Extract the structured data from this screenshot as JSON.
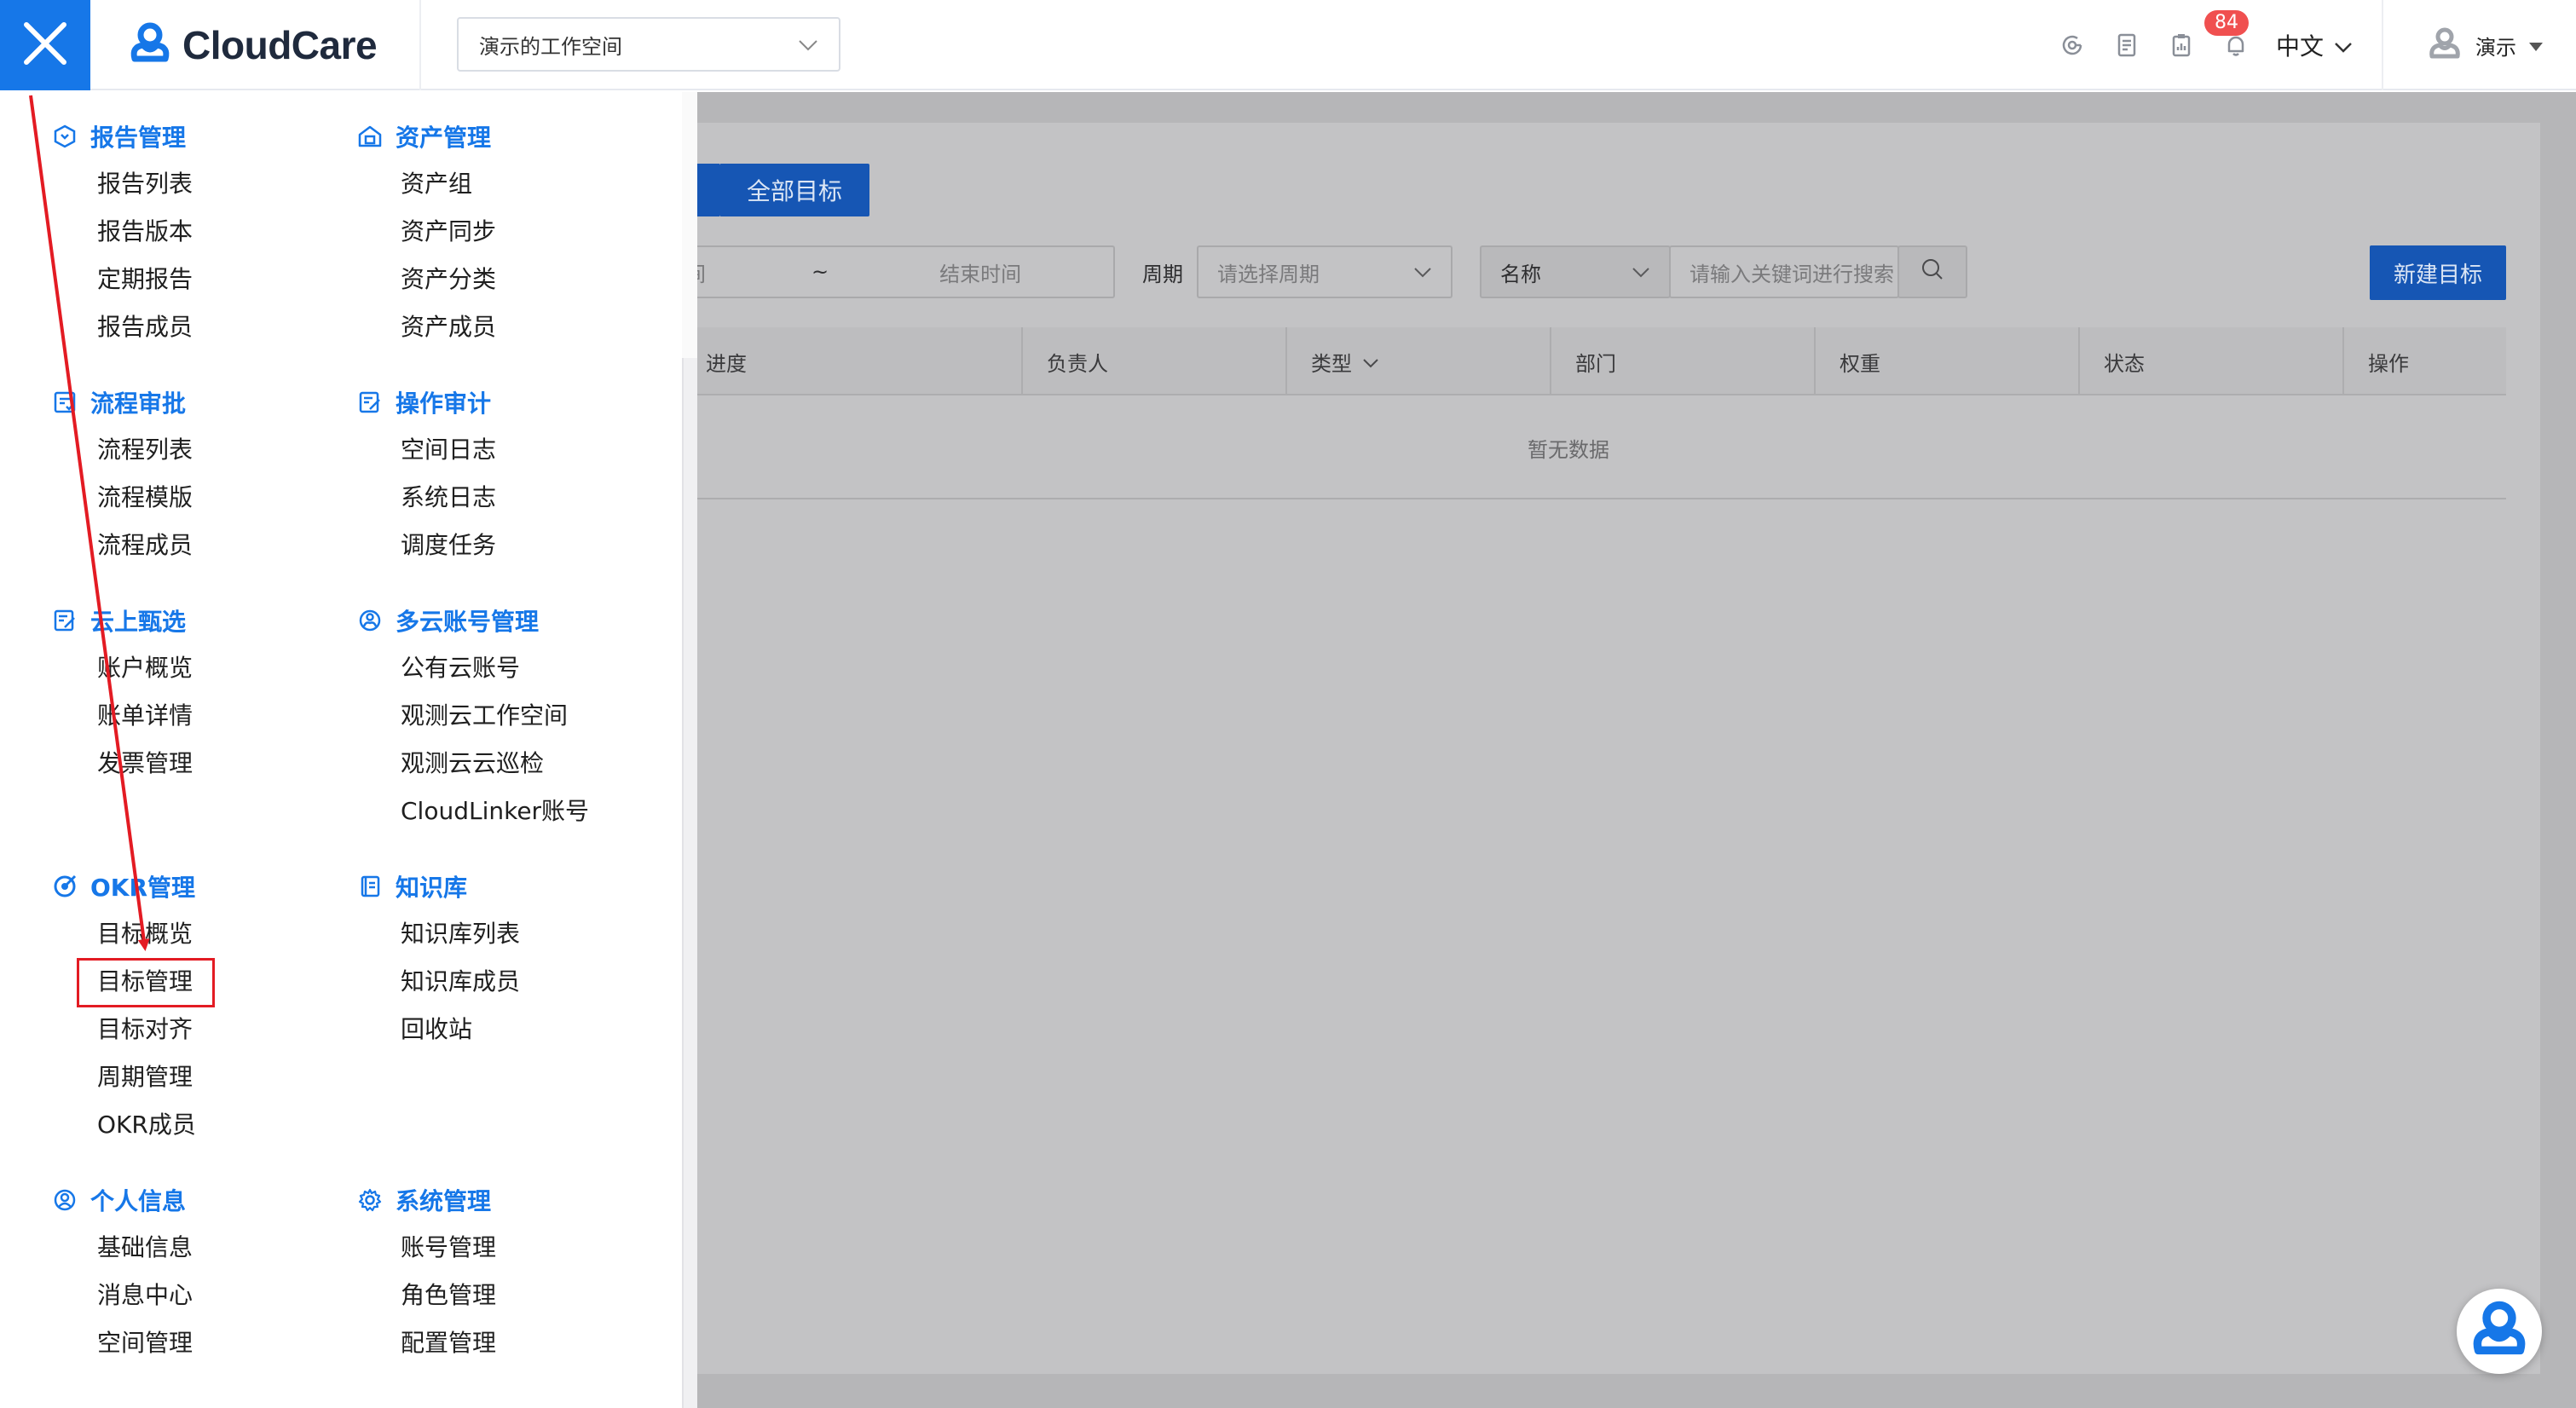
{
  "header": {
    "logo_text": "CloudCare",
    "workspace_selected": "演示的工作空间",
    "notification_count": "84",
    "language": "中文",
    "user_name": "演示",
    "icons": [
      "refresh-icon",
      "document-icon",
      "report-icon",
      "bell-icon"
    ]
  },
  "page": {
    "tab_label": "全部目标",
    "date_range_separator": "~",
    "date_start_partial": "间",
    "date_end_placeholder": "结束时间",
    "period_label": "周期",
    "period_placeholder": "请选择周期",
    "search_field_selected": "名称",
    "search_placeholder": "请输入关键词进行搜索",
    "new_button": "新建目标",
    "table_columns": [
      "进度",
      "负责人",
      "类型",
      "部门",
      "权重",
      "状态",
      "操作"
    ],
    "empty_text": "暂无数据"
  },
  "menu": {
    "left": [
      {
        "title": "报告管理",
        "icon": "report-hex-icon",
        "items": [
          "报告列表",
          "报告版本",
          "定期报告",
          "报告成员"
        ]
      },
      {
        "title": "流程审批",
        "icon": "approval-icon",
        "items": [
          "流程列表",
          "流程模版",
          "流程成员"
        ]
      },
      {
        "title": "云上甄选",
        "icon": "edit-doc-icon",
        "items": [
          "账户概览",
          "账单详情",
          "发票管理"
        ]
      },
      {
        "title": "OKR管理",
        "icon": "target-icon",
        "items": [
          "目标概览",
          "目标管理",
          "目标对齐",
          "周期管理",
          "OKR成员"
        ]
      },
      {
        "title": "个人信息",
        "icon": "user-circle-icon",
        "items": [
          "基础信息",
          "消息中心",
          "空间管理"
        ]
      }
    ],
    "right": [
      {
        "title": "资产管理",
        "icon": "asset-home-icon",
        "items": [
          "资产组",
          "资产同步",
          "资产分类",
          "资产成员"
        ]
      },
      {
        "title": "操作审计",
        "icon": "audit-icon",
        "items": [
          "空间日志",
          "系统日志",
          "调度任务"
        ]
      },
      {
        "title": "多云账号管理",
        "icon": "cloud-account-icon",
        "items": [
          "公有云账号",
          "观测云工作空间",
          "观测云云巡检",
          "CloudLinker账号"
        ]
      },
      {
        "title": "知识库",
        "icon": "book-icon",
        "items": [
          "知识库列表",
          "知识库成员",
          "回收站"
        ]
      },
      {
        "title": "系统管理",
        "icon": "gear-icon",
        "items": [
          "账号管理",
          "角色管理",
          "配置管理"
        ]
      }
    ]
  },
  "colors": {
    "accent": "#1677e8",
    "annotation": "#e31b23",
    "badge": "#f05050"
  }
}
